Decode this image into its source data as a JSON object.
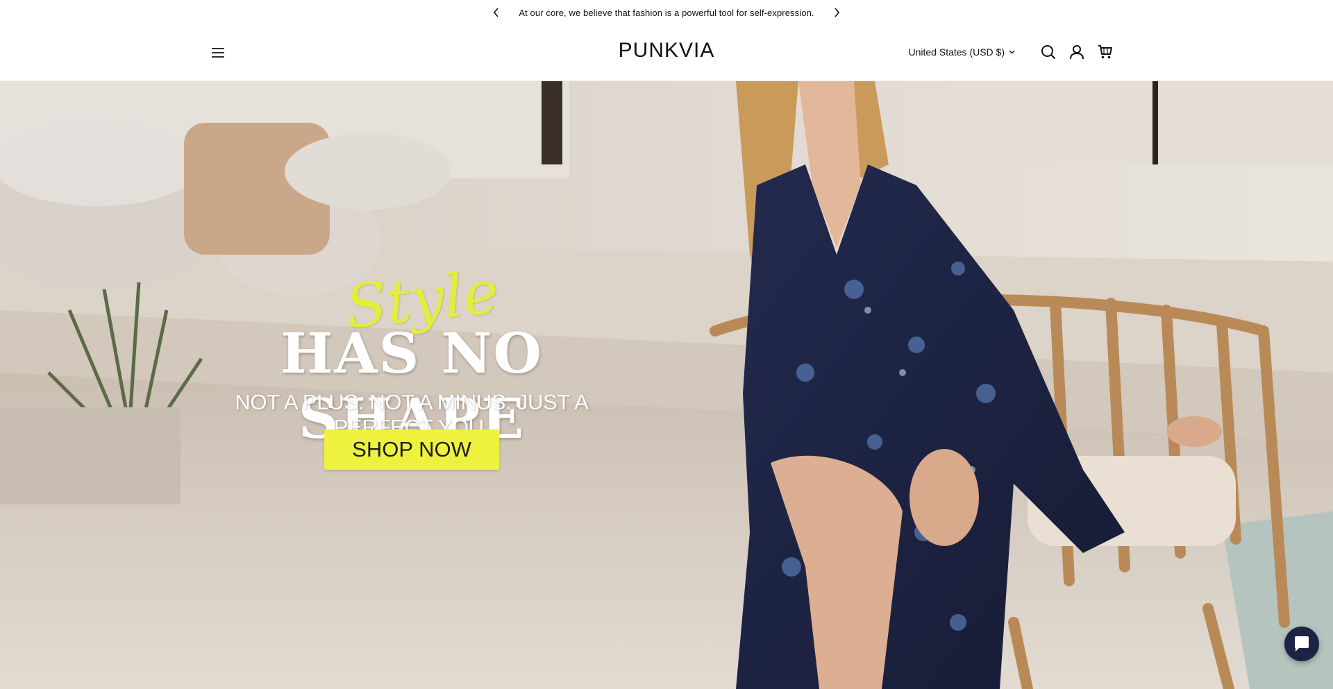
{
  "announcement": {
    "message": "At our core, we believe that fashion is a powerful tool for self-expression."
  },
  "header": {
    "logo": "PUNKVIA",
    "currency": "United States (USD $)"
  },
  "hero": {
    "script_word": "Style",
    "headline": "HAS NO SHAPE",
    "tagline": "NOT A PLUS. NOT A MINUS. JUST A PERFECT YOU.",
    "cta_label": "SHOP NOW"
  },
  "colors": {
    "accent": "#eef23f",
    "chat": "#1e2346",
    "dress": "#1f2645"
  },
  "icons": [
    "chevron-left-icon",
    "chevron-right-icon",
    "menu-icon",
    "chevron-down-icon",
    "search-icon",
    "account-icon",
    "cart-icon",
    "chat-icon"
  ]
}
